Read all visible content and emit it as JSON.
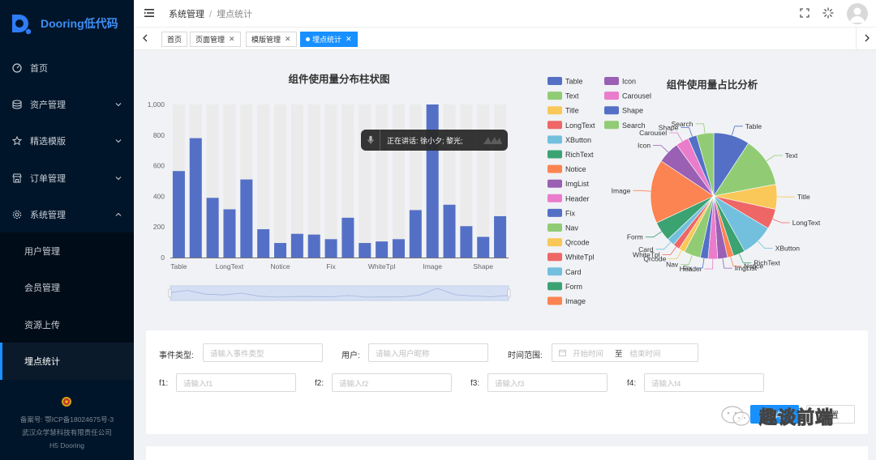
{
  "app": {
    "title": "Dooring低代码"
  },
  "sidebar": {
    "items": [
      {
        "label": "首页",
        "icon": "dashboard-icon"
      },
      {
        "label": "资产管理",
        "icon": "database-icon"
      },
      {
        "label": "精选模版",
        "icon": "star-icon"
      },
      {
        "label": "订单管理",
        "icon": "shop-icon"
      },
      {
        "label": "系统管理",
        "icon": "setting-icon"
      }
    ],
    "sub_items": [
      {
        "label": "用户管理"
      },
      {
        "label": "会员管理"
      },
      {
        "label": "资源上传"
      },
      {
        "label": "埋点统计"
      }
    ],
    "footer": {
      "icp": "备案号: 鄂ICP备18024675号-3",
      "company": "武汉众学慧科技有限责任公司",
      "product": "H5 Dooring"
    }
  },
  "header": {
    "breadcrumb": [
      "系统管理",
      "埋点统计"
    ],
    "separator": "/"
  },
  "tabs": [
    {
      "label": "首页",
      "closable": false,
      "active": false
    },
    {
      "label": "页面管理",
      "closable": true,
      "active": false
    },
    {
      "label": "模版管理",
      "closable": true,
      "active": false
    },
    {
      "label": "埋点统计",
      "closable": true,
      "active": true
    }
  ],
  "voice_overlay": {
    "text": "正在讲话: 徐小夕; 黎光;"
  },
  "chart_data": [
    {
      "type": "bar",
      "title": "组件使用量分布柱状图",
      "categories": [
        "Table",
        "Text",
        "Title",
        "LongText",
        "XButton",
        "RichText",
        "Notice",
        "ImgList",
        "Header",
        "Fix",
        "Nav",
        "Qrcode",
        "WhiteTpl",
        "Card",
        "Form",
        "Image",
        "Icon",
        "Carousel",
        "Shape",
        "Search"
      ],
      "tick_labels": [
        "Table",
        "",
        "",
        "LongText",
        "",
        "",
        "Notice",
        "",
        "",
        "Fix",
        "",
        "",
        "WhiteTpl",
        "",
        "",
        "Image",
        "",
        "",
        "Shape",
        ""
      ],
      "values": [
        565,
        780,
        390,
        315,
        510,
        185,
        95,
        155,
        150,
        120,
        260,
        95,
        105,
        120,
        310,
        1000,
        345,
        205,
        135,
        270
      ],
      "ylim": [
        0,
        1000
      ],
      "yticks": [
        "0",
        "200",
        "400",
        "600",
        "800",
        "1,000"
      ],
      "color": "#5470c6",
      "background_bar_color": "#ebebeb",
      "datazoom": true
    },
    {
      "type": "pie",
      "title": "组件使用量占比分析",
      "categories": [
        "Table",
        "Text",
        "Title",
        "LongText",
        "XButton",
        "RichText",
        "Notice",
        "ImgList",
        "Header",
        "Fix",
        "Nav",
        "Qrcode",
        "WhiteTpl",
        "Card",
        "Form",
        "Image",
        "Icon",
        "Carousel",
        "Shape",
        "Search"
      ],
      "values": [
        565,
        780,
        390,
        315,
        510,
        185,
        95,
        155,
        150,
        120,
        260,
        95,
        105,
        120,
        310,
        1000,
        345,
        205,
        135,
        270
      ],
      "colors": [
        "#5470c6",
        "#91cc75",
        "#fac858",
        "#ee6666",
        "#73c0de",
        "#3ba272",
        "#fc8452",
        "#9a60b4",
        "#ea7ccc",
        "#5470c6",
        "#91cc75",
        "#fac858",
        "#ee6666",
        "#73c0de",
        "#3ba272",
        "#fc8452",
        "#9a60b4",
        "#ea7ccc",
        "#5470c6",
        "#91cc75"
      ],
      "legend_placement": "left, two columns"
    }
  ],
  "filter": {
    "event_type_label": "事件类型:",
    "event_type_placeholder": "请输入事件类型",
    "user_label": "用户:",
    "user_placeholder": "请输入用户昵称",
    "time_label": "时间范围:",
    "start_placeholder": "开始时间",
    "range_sep": "至",
    "end_placeholder": "结束时间",
    "f1_label": "f1:",
    "f1_placeholder": "请输入f1",
    "f2_label": "f2:",
    "f2_placeholder": "请输入f2",
    "f3_label": "f3:",
    "f3_placeholder": "请输入f3",
    "f4_label": "f4:",
    "f4_placeholder": "请输入f4",
    "search_button": "查询",
    "reset_button": "重置"
  },
  "watermark": {
    "text": "趣谈前端"
  },
  "colors": {
    "sider": "#001529",
    "primary": "#1890ff",
    "logo": "#3f8ef5"
  }
}
